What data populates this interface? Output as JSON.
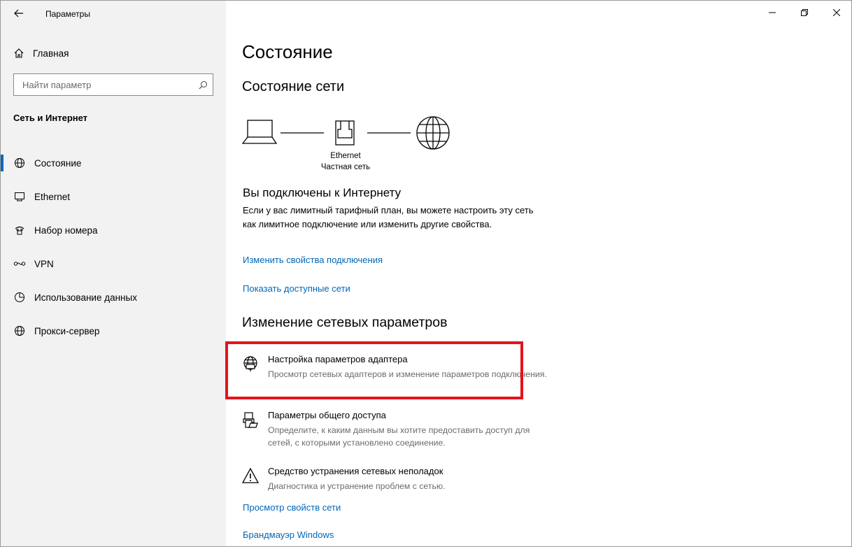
{
  "window": {
    "title": "Параметры"
  },
  "sidebar": {
    "home_label": "Главная",
    "search_placeholder": "Найти параметр",
    "section_title": "Сеть и Интернет",
    "items": [
      {
        "label": "Состояние",
        "icon": "globe-icon",
        "active": true
      },
      {
        "label": "Ethernet",
        "icon": "ethernet-icon",
        "active": false
      },
      {
        "label": "Набор номера",
        "icon": "dialup-icon",
        "active": false
      },
      {
        "label": "VPN",
        "icon": "vpn-icon",
        "active": false
      },
      {
        "label": "Использование данных",
        "icon": "data-usage-icon",
        "active": false
      },
      {
        "label": "Прокси-сервер",
        "icon": "globe-icon",
        "active": false
      }
    ]
  },
  "main": {
    "title": "Состояние",
    "network_status_heading": "Состояние сети",
    "diagram": {
      "adapter_name": "Ethernet",
      "network_name": "Частная сеть"
    },
    "connected_heading": "Вы подключены к Интернету",
    "connected_text": "Если у вас лимитный тарифный план, вы можете настроить эту сеть как лимитное подключение или изменить другие свойства.",
    "link_change_properties": "Изменить свойства подключения",
    "link_show_networks": "Показать доступные сети",
    "change_settings_heading": "Изменение сетевых параметров",
    "settings": [
      {
        "title": "Настройка параметров адаптера",
        "desc": "Просмотр сетевых адаптеров и изменение параметров подключения.",
        "icon": "adapter-icon"
      },
      {
        "title": "Параметры общего доступа",
        "desc": "Определите, к каким данным вы хотите предоставить доступ для сетей, с которыми установлено соединение.",
        "icon": "sharing-icon"
      },
      {
        "title": "Средство устранения сетевых неполадок",
        "desc": "Диагностика и устранение проблем с сетью.",
        "icon": "warning-icon"
      }
    ],
    "link_view_properties": "Просмотр свойств сети",
    "link_firewall": "Брандмауэр Windows"
  },
  "colors": {
    "accent": "#0067c0",
    "link": "#0067b8",
    "highlight": "#e5131b",
    "sidebar_bg": "#f2f2f2"
  }
}
